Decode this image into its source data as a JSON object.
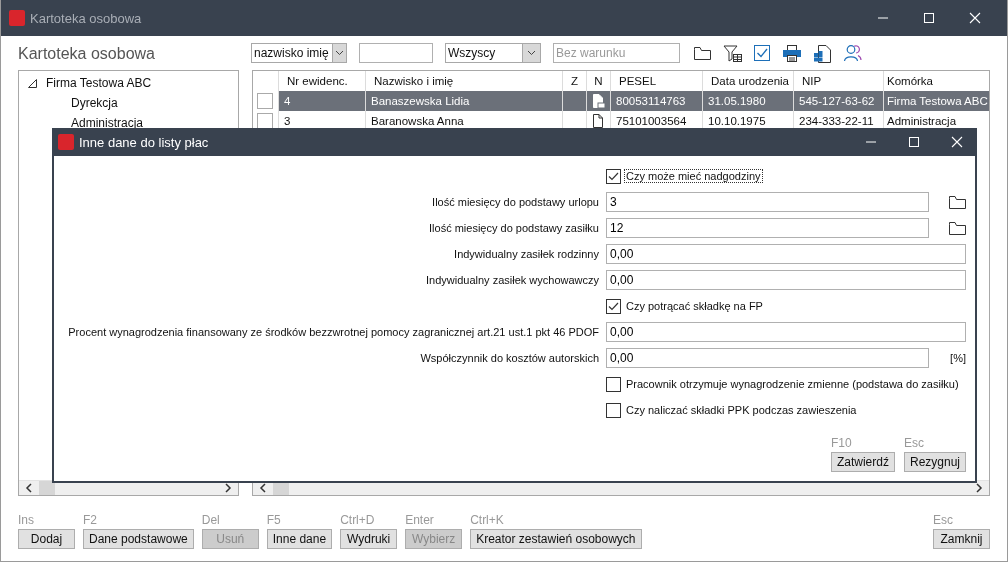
{
  "window": {
    "title": "Kartoteka osobowa"
  },
  "heading": "Kartoteka osobowa",
  "toolbar": {
    "sort_select": {
      "value": "nazwisko imię"
    },
    "filter_select": {
      "value": "Wszyscy"
    },
    "condition_field": {
      "placeholder": "Bez warunku"
    }
  },
  "tree": [
    {
      "label": "Firma Testowa ABC",
      "expanded": true,
      "children": [
        {
          "label": "Dyrekcja"
        },
        {
          "label": "Administracja"
        }
      ]
    }
  ],
  "table": {
    "columns": [
      "Nr ewidenc.",
      "Nazwisko i imię",
      "Z",
      "N",
      "PESEL",
      "Data urodzenia",
      "NIP",
      "Komórka"
    ],
    "rows": [
      {
        "selected": true,
        "checked": false,
        "nr": "4",
        "name": "Banaszewska Lidia",
        "pesel": "80053114763",
        "birth_date": "31.05.1980",
        "nip": "545-127-63-62",
        "unit": "Firma Testowa ABC"
      },
      {
        "selected": false,
        "checked": false,
        "nr": "3",
        "name": "Baranowska Anna",
        "pesel": "75101003564",
        "birth_date": "10.10.1975",
        "nip": "234-333-22-11",
        "unit": "Administracja"
      }
    ]
  },
  "dialog": {
    "title": "Inne dane do listy płac",
    "rows": [
      {
        "kind": "checkbox",
        "label": "Czy może mieć nadgodziny",
        "checked": true,
        "focused": true
      },
      {
        "kind": "field",
        "label": "Ilość miesięcy do podstawy urlopu",
        "value": "3",
        "picker": true
      },
      {
        "kind": "field",
        "label": "Ilość miesięcy do podstawy zasiłku",
        "value": "12",
        "picker": true
      },
      {
        "kind": "field",
        "label": "Indywidualny zasiłek rodzinny",
        "value": "0,00"
      },
      {
        "kind": "field",
        "label": "Indywidualny zasiłek wychowawczy",
        "value": "0,00"
      },
      {
        "kind": "checkbox",
        "label": "Czy potrącać składkę na FP",
        "checked": true,
        "focused": false
      },
      {
        "kind": "field",
        "label": "Procent wynagrodzenia finansowany ze środków bezzwrotnej pomocy zagranicznej art.21 ust.1 pkt 46 PDOF",
        "value": "0,00"
      },
      {
        "kind": "field",
        "label": "Współczynnik do kosztów autorskich",
        "value": "0,00",
        "suffix": "[%]"
      },
      {
        "kind": "checkbox",
        "label": "Pracownik otrzymuje wynagrodzenie zmienne (podstawa do zasiłku)",
        "checked": false,
        "focused": false
      },
      {
        "kind": "checkbox",
        "label": "Czy naliczać składki PPK podczas zawieszenia",
        "checked": false,
        "focused": false
      }
    ],
    "buttons": [
      {
        "hotkey": "F10",
        "label": "Zatwierdź"
      },
      {
        "hotkey": "Esc",
        "label": "Rezygnuj"
      }
    ]
  },
  "footer": {
    "buttons": [
      {
        "hotkey": "Ins",
        "label": "Dodaj",
        "disabled": false
      },
      {
        "hotkey": "F2",
        "label": "Dane podstawowe",
        "disabled": false
      },
      {
        "hotkey": "Del",
        "label": "Usuń",
        "disabled": true
      },
      {
        "hotkey": "F5",
        "label": "Inne dane",
        "disabled": false
      },
      {
        "hotkey": "Ctrl+D",
        "label": "Wydruki",
        "disabled": false
      },
      {
        "hotkey": "Enter",
        "label": "Wybierz",
        "disabled": true
      },
      {
        "hotkey": "Ctrl+K",
        "label": "Kreator zestawień osobowych",
        "disabled": false
      }
    ],
    "close_button": {
      "hotkey": "Esc",
      "label": "Zamknij"
    }
  }
}
